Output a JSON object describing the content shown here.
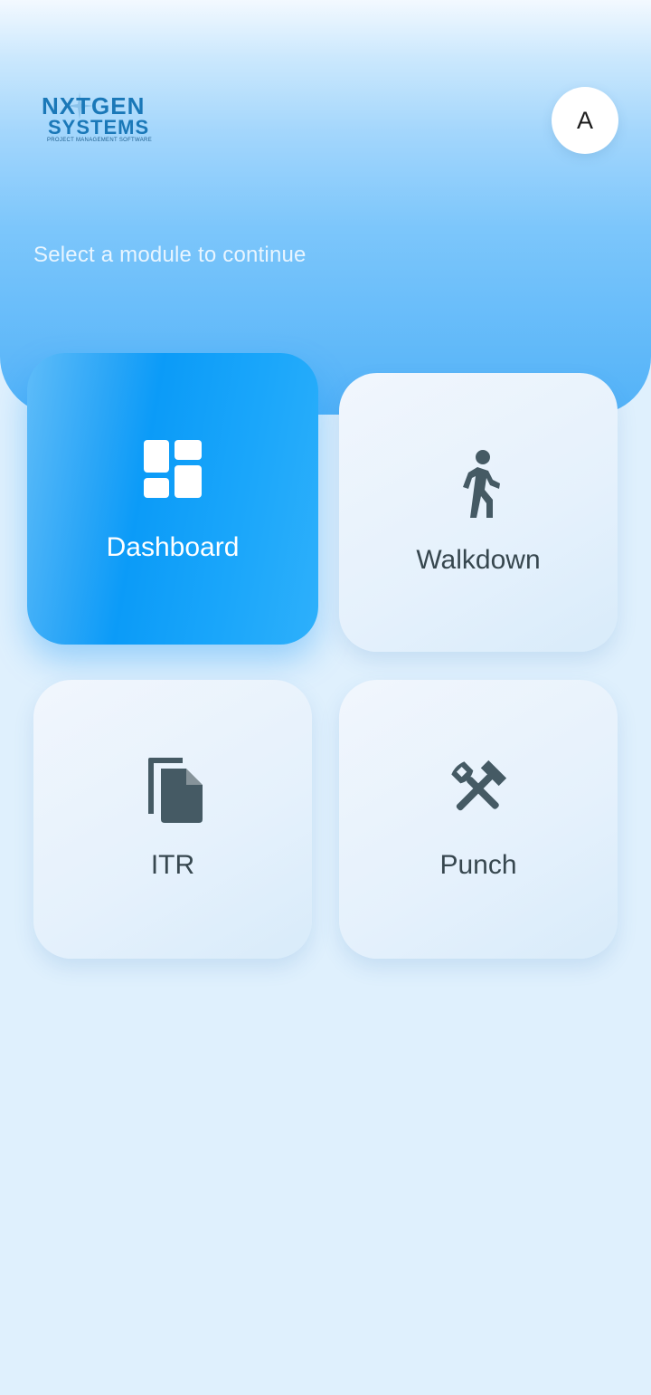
{
  "header": {
    "logo": {
      "line1": "NXTGEN",
      "line2": "SYSTEMS",
      "tagline": "PROJECT MANAGEMENT SOFTWARE"
    },
    "avatar_initial": "A",
    "subtitle": "Select a module to continue"
  },
  "modules": [
    {
      "label": "Dashboard",
      "icon": "dashboard-icon",
      "selected": true
    },
    {
      "label": "Walkdown",
      "icon": "walking-person-icon",
      "selected": false
    },
    {
      "label": "ITR",
      "icon": "documents-icon",
      "selected": false
    },
    {
      "label": "Punch",
      "icon": "tools-icon",
      "selected": false
    }
  ],
  "colors": {
    "accent": "#0b9bf8",
    "header_top": "#f3f9ff",
    "header_bottom": "#52b2f8",
    "background": "#dff0fd",
    "icon": "#455a64",
    "logo": "#1a78b8"
  }
}
